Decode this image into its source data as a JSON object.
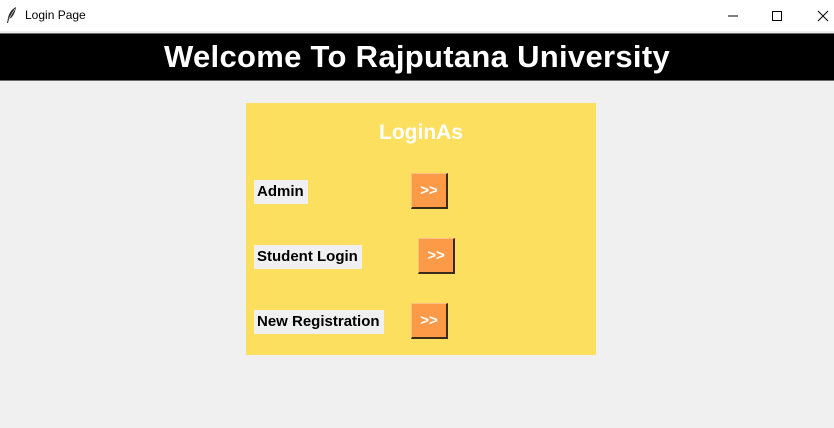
{
  "window": {
    "title": "Login Page",
    "icon": "feather-icon",
    "controls": [
      "minimize-icon",
      "maximize-icon",
      "close-icon"
    ]
  },
  "banner": {
    "text": "Welcome To Rajputana University",
    "background": "#000000",
    "color": "#ffffff"
  },
  "panel": {
    "title": "LoginAs",
    "background": "#fddf60",
    "options": [
      {
        "label": "Admin",
        "button": ">>"
      },
      {
        "label": "Student Login",
        "button": ">>"
      },
      {
        "label": "New Registration",
        "button": ">>"
      }
    ],
    "button_color": "#fc9a48"
  }
}
